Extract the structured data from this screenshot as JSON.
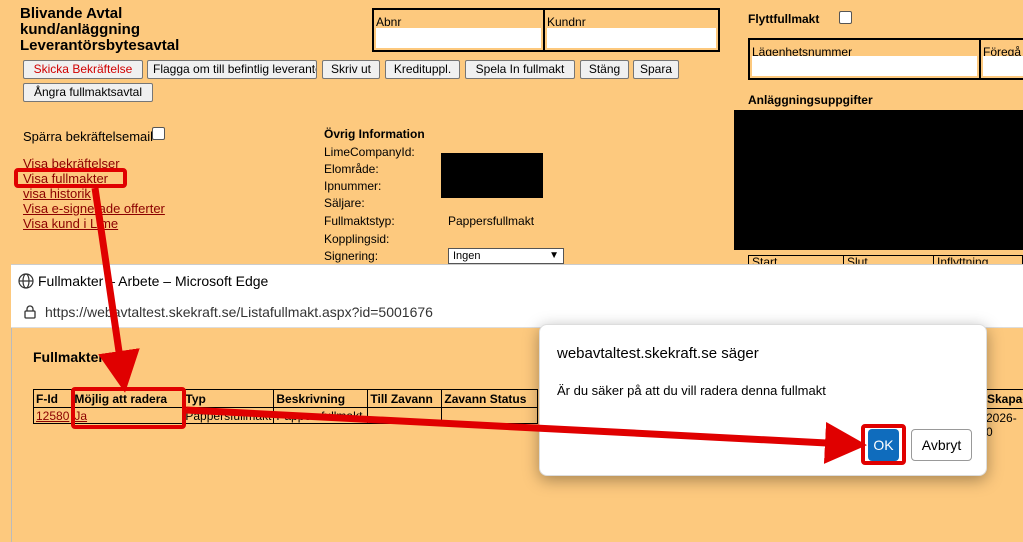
{
  "header": {
    "title_line1": "Blivande Avtal",
    "title_line2": "kund/anläggning",
    "title_line3": "Leverantörsbytesavtal",
    "abnr_label": "Abnr",
    "kundnr_label": "Kundnr",
    "flyttfullmakt_label": "Flyttfullmakt",
    "lagenhetsnummer_label": "Lägenhetsnummer",
    "foregaende_label": "Föregå",
    "anlaggningsuppgifter_label": "Anläggningsuppgifter",
    "start_label": "Start",
    "slut_label": "Slut",
    "inflyttning_label": "Inflyttning"
  },
  "toolbar": {
    "skicka": "Skicka Bekräftelse",
    "flagga": "Flagga om till befintlig leverantör",
    "skriv_ut": "Skriv ut",
    "kredit": "Kredituppl.",
    "spela_in": "Spela In fullmakt",
    "stang": "Stäng",
    "spara": "Spara",
    "angra": "Ångra fullmaktsavtal"
  },
  "left": {
    "sparra_label": "Spärra bekräftelsemail",
    "links": [
      "Visa bekräftelser",
      "Visa fullmakter",
      "visa historik",
      "Visa e-signerade offerter",
      "Visa kund i Lime"
    ]
  },
  "ovrig": {
    "heading": "Övrig Information",
    "labels": [
      "LimeCompanyId:",
      "Elområde:",
      "Ipnummer:",
      "Säljare:",
      "Fullmaktstyp:",
      "Kopplingsid:",
      "Signering:"
    ],
    "fullmaktstyp_value": "Pappersfullmakt",
    "signering_value": "Ingen"
  },
  "browser": {
    "window_title": "Fullmakter – Arbete – Microsoft Edge",
    "url": "https://webavtaltest.skekraft.se/Listafullmakt.aspx?id=5001676"
  },
  "fullmakter": {
    "heading": "Fullmakter",
    "columns": [
      "F-Id",
      "Möjlig att radera",
      "Typ",
      "Beskrivning",
      "Till Zavann",
      "Zavann Status"
    ],
    "row": [
      "12580",
      "Ja",
      "Pappersfullmakt",
      "Pappersfullmakt",
      "",
      ""
    ],
    "skapad_label": "Skapad",
    "skapad_value": "2026-0"
  },
  "dialog": {
    "title": "webavtaltest.skekraft.se säger",
    "message": "Är du säker på att du vill radera denna fullmakt",
    "ok": "OK",
    "cancel": "Avbryt"
  },
  "colors": {
    "page_bg": "#fdc97e",
    "link": "#8b0000",
    "annotation_red": "#e00000",
    "ok_blue": "#0f6cbd"
  }
}
